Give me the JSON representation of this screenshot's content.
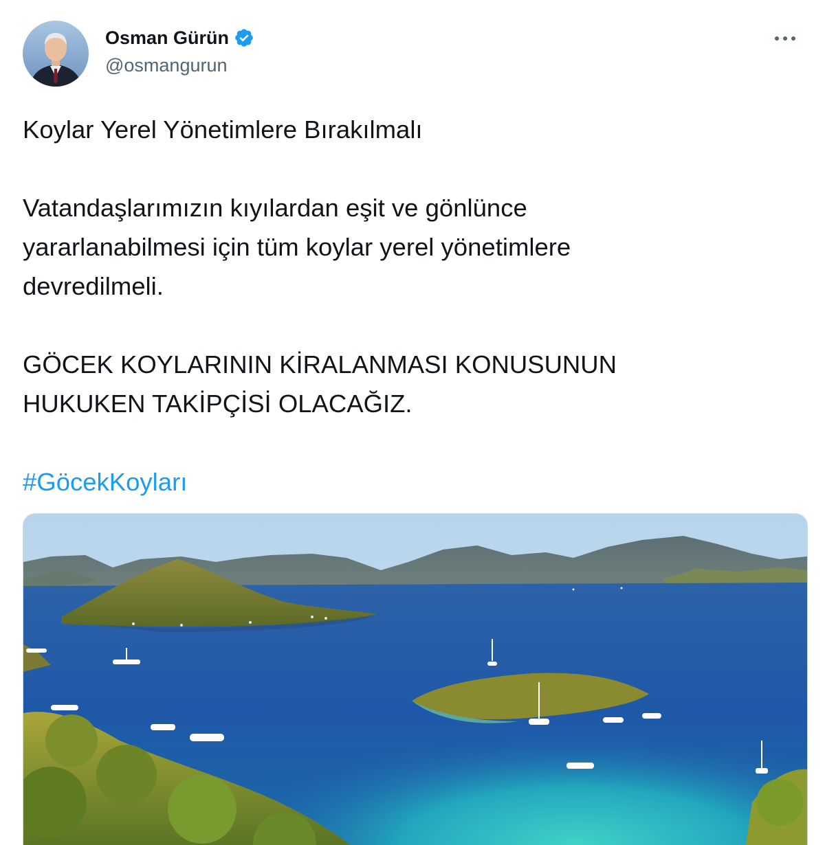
{
  "tweet": {
    "author": {
      "display_name": "Osman Gürün",
      "handle": "@osmangurun",
      "verified": true
    },
    "more_label": "•••",
    "text": {
      "title": "Koylar Yerel Yönetimlere Bırakılmalı",
      "paragraph_1_line_1": "Vatandaşlarımızın kıyılardan eşit ve gönlünce",
      "paragraph_1_line_2": "yararlanabilmesi için tüm koylar yerel yönetimlere",
      "paragraph_1_line_3": "devredilmeli.",
      "paragraph_2_line_1": "GÖCEK KOYLARININ KİRALANMASI KONUSUNUN",
      "paragraph_2_line_2": "HUKUKEN TAKİPÇİSİ OLACAĞIZ.",
      "hashtag": "#GöcekKoyları"
    },
    "media": {
      "type": "photo",
      "subject": "aerial-bay-islands-photo"
    }
  },
  "colors": {
    "accent": "#1d9bf0",
    "text_primary": "#0f1419",
    "text_secondary": "#536471",
    "verified_badge": "#1d9bf0"
  }
}
